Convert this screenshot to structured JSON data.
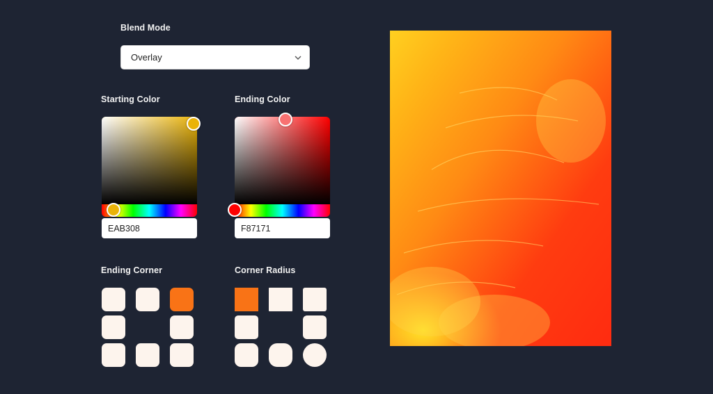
{
  "blend_mode": {
    "label": "Blend Mode",
    "value": "Overlay"
  },
  "starting_color": {
    "label": "Starting Color",
    "hex": "EAB308",
    "hue_color": "#eab308",
    "accent": "#EAB308"
  },
  "ending_color": {
    "label": "Ending Color",
    "hex": "F87171",
    "hue_color": "#ff0000",
    "accent": "#F87171"
  },
  "ending_corner": {
    "label": "Ending Corner",
    "selected": "top-right"
  },
  "corner_radius": {
    "label": "Corner Radius",
    "selected": "square"
  },
  "colors": {
    "background": "#1e2433",
    "cell": "#fdf4ed",
    "selected": "#f97316"
  },
  "preview": {
    "icon": "image-preview"
  }
}
